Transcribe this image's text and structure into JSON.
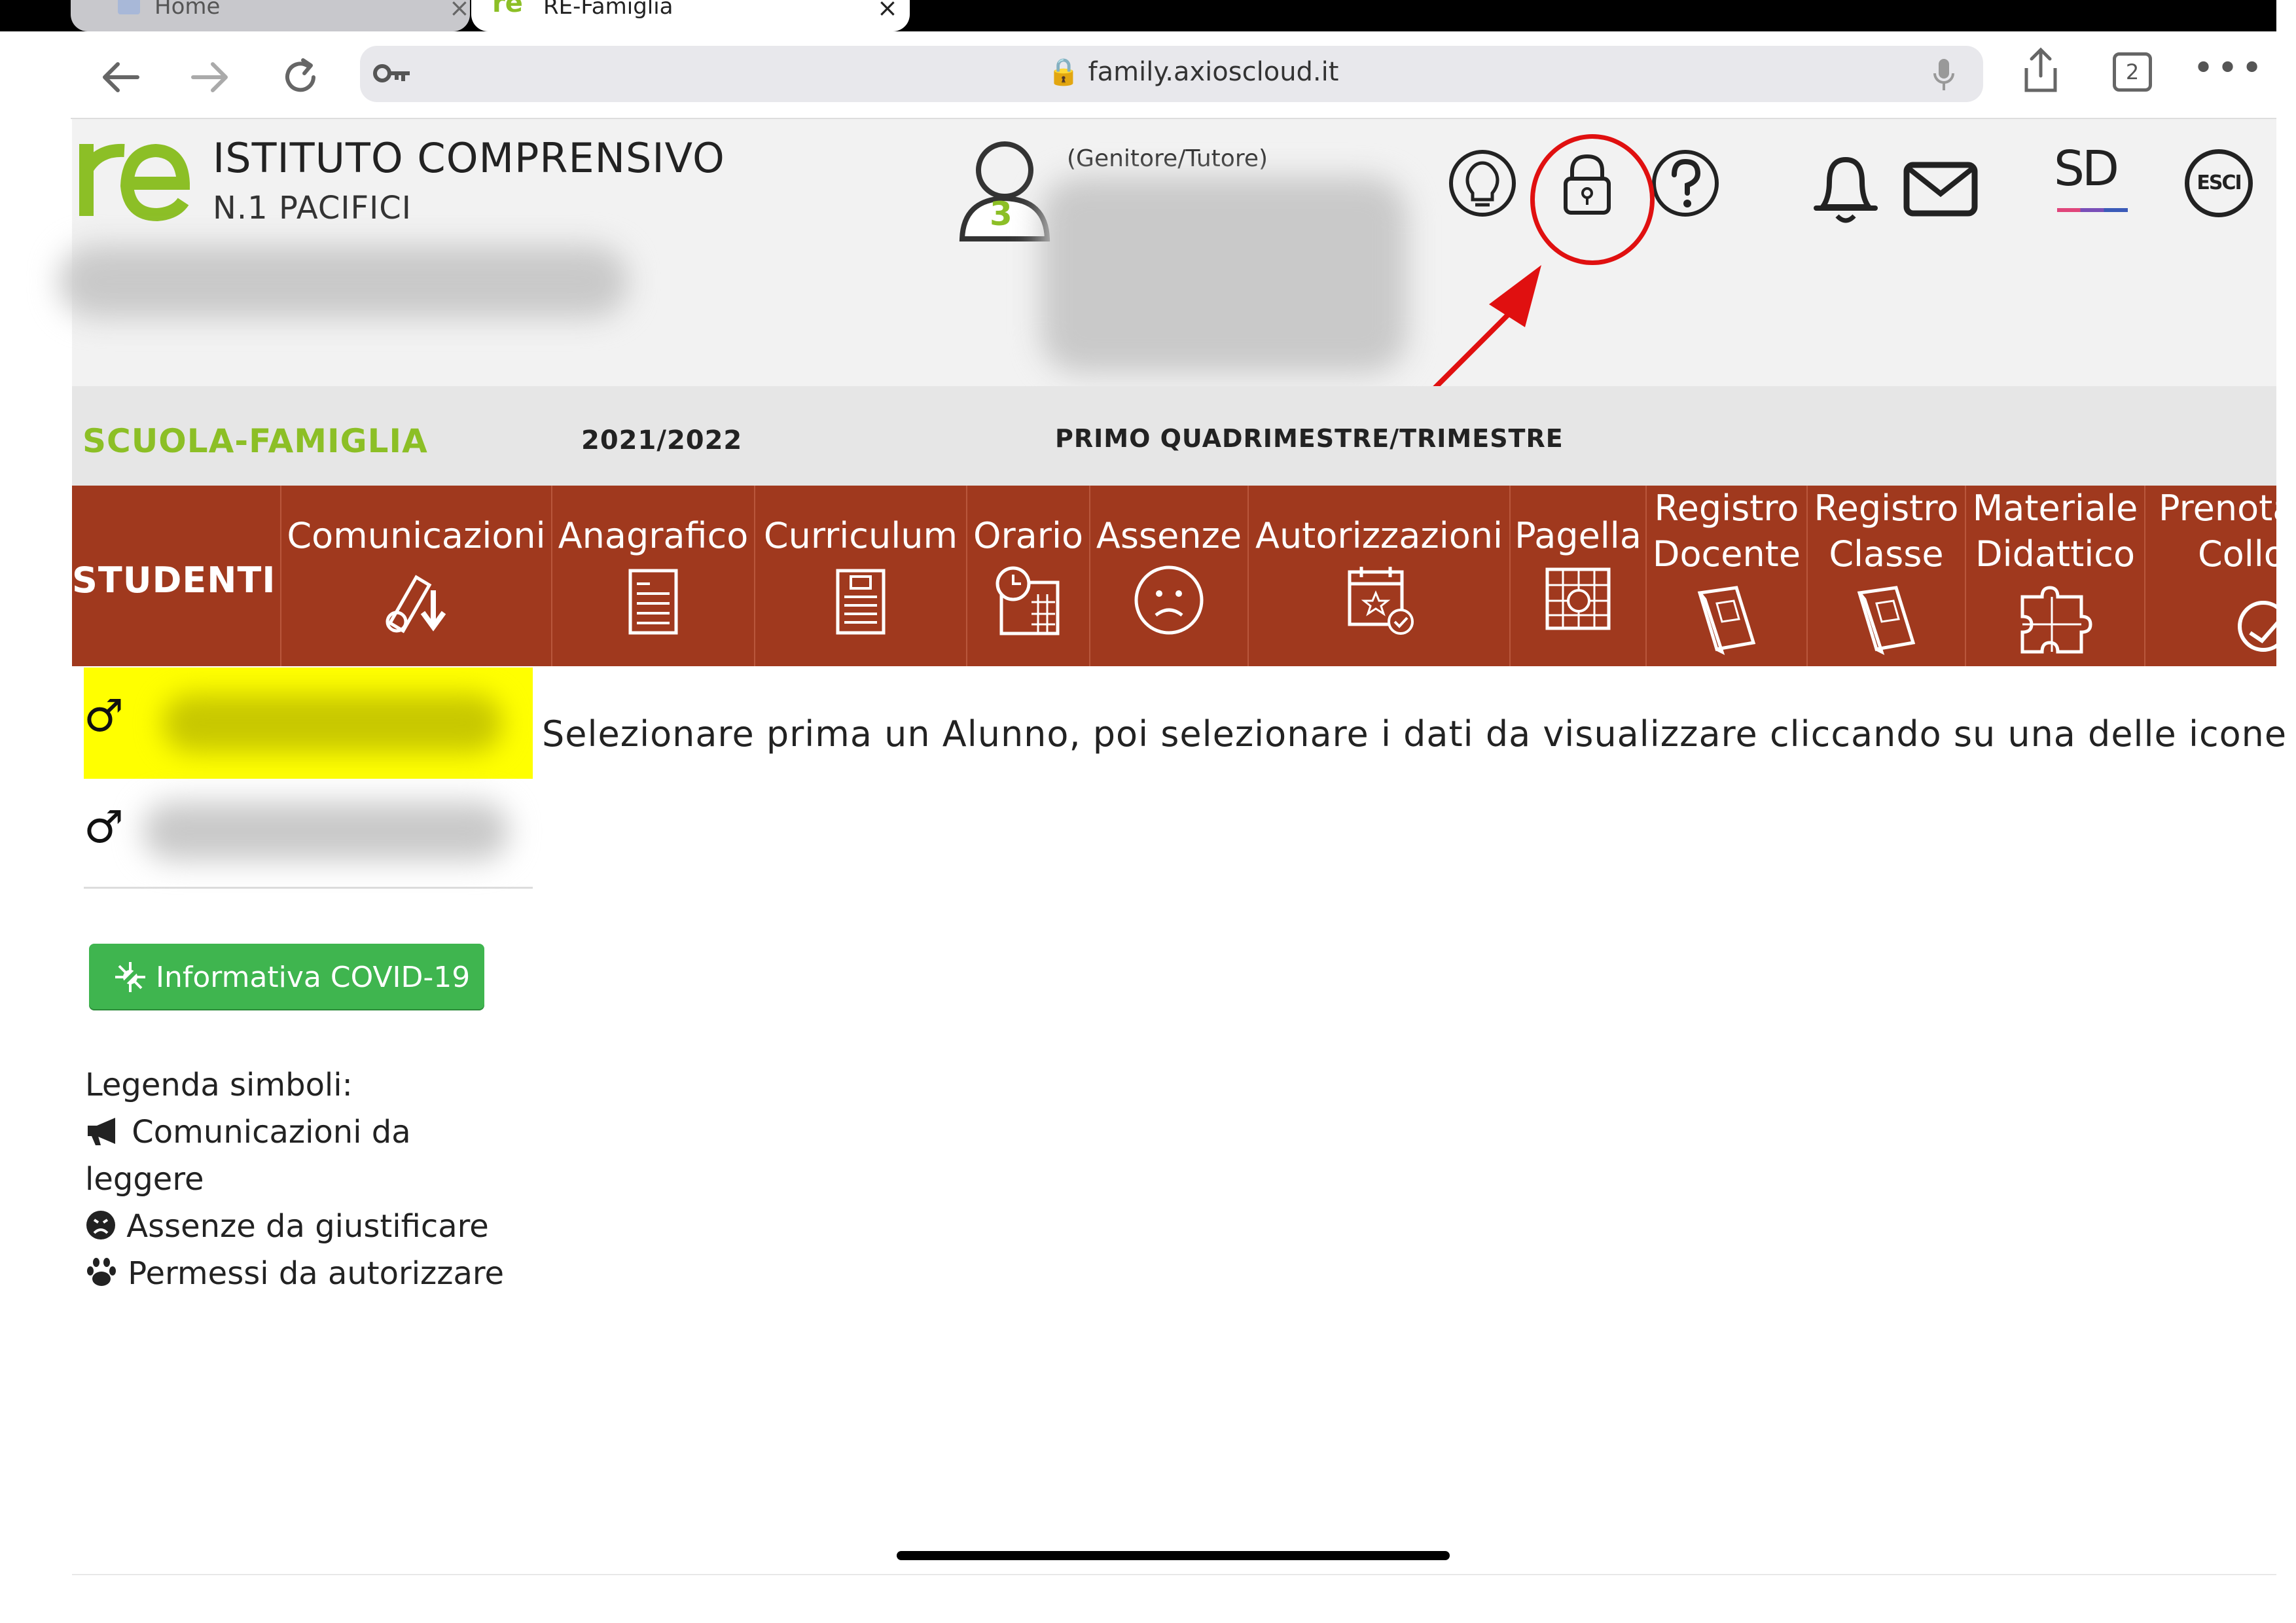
{
  "browser": {
    "tabs": [
      {
        "label": "Home",
        "active": false
      },
      {
        "label": "RE-Famiglia",
        "active": true
      }
    ],
    "url": "family.axioscloud.it",
    "tab_count": "2"
  },
  "header": {
    "logo_text": "re",
    "school_name": "ISTITUTO COMPRENSIVO",
    "school_subtitle": "N.1 PACIFICI",
    "user_badge": "3",
    "user_role": "(Genitore/Tutore)",
    "icons": [
      "lightbulb-icon",
      "lock-icon",
      "help-icon",
      "bell-icon",
      "mail-icon",
      "sd-icon",
      "exit-icon"
    ],
    "sd_label": "SD",
    "exit_label": "ESCI"
  },
  "infobar": {
    "section": "SCUOLA-FAMIGLIA",
    "year": "2021/2022",
    "period": "PRIMO QUADRIMESTRE/TRIMESTRE"
  },
  "menu": {
    "students_label": "STUDENTI",
    "items": [
      {
        "label1": "Comunicazioni",
        "label2": "",
        "icon": "megaphone-icon"
      },
      {
        "label1": "Anagrafico",
        "label2": "",
        "icon": "profile-document-icon"
      },
      {
        "label1": "Curriculum",
        "label2": "",
        "icon": "curriculum-document-icon"
      },
      {
        "label1": "Orario",
        "label2": "",
        "icon": "schedule-icon"
      },
      {
        "label1": "Assenze",
        "label2": "",
        "icon": "sad-face-icon"
      },
      {
        "label1": "Autorizzazioni",
        "label2": "",
        "icon": "calendar-check-icon"
      },
      {
        "label1": "Pagella",
        "label2": "",
        "icon": "report-card-icon"
      },
      {
        "label1": "Registro",
        "label2": "Docente",
        "icon": "book-icon"
      },
      {
        "label1": "Registro",
        "label2": "Classe",
        "icon": "book-icon"
      },
      {
        "label1": "Materiale",
        "label2": "Didattico",
        "icon": "puzzle-icon"
      },
      {
        "label1": "Prenota",
        "label2": "Collo",
        "icon": "handshake-icon"
      }
    ]
  },
  "sidebar": {
    "students": [
      {
        "symbol": "♂",
        "selected": true
      },
      {
        "symbol": "♂",
        "selected": false
      }
    ],
    "covid_button": "Informativa COVID-19",
    "legend_title": "Legenda simboli:",
    "legend": [
      {
        "icon": "megaphone-icon",
        "text1": "Comunicazioni da",
        "text2": "leggere"
      },
      {
        "icon": "frown-circle-icon",
        "text1": "Assenze da giustificare",
        "text2": ""
      },
      {
        "icon": "paw-icon",
        "text1": "Permessi da autorizzare",
        "text2": ""
      }
    ]
  },
  "main": {
    "instruction": "Selezionare prima un Alunno, poi selezionare i dati da visualizzare cliccando su una delle icone s"
  },
  "colors": {
    "menu_bg": "#a0391e",
    "logo_green": "#8cbf26",
    "highlight": "#ffff00",
    "covid_green": "#3fb54f",
    "annotation_red": "#e01010"
  }
}
